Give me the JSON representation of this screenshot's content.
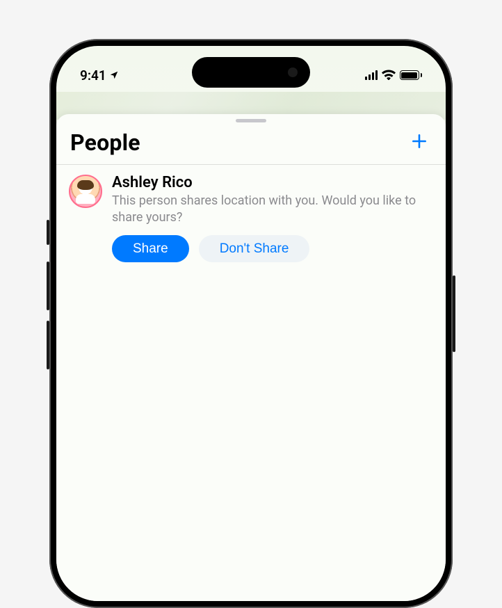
{
  "status": {
    "time": "9:41"
  },
  "sheet": {
    "title": "People"
  },
  "person": {
    "name": "Ashley Rico",
    "message": "This person shares location with you. Would you like to share yours?",
    "share_label": "Share",
    "dont_share_label": "Don't Share"
  }
}
